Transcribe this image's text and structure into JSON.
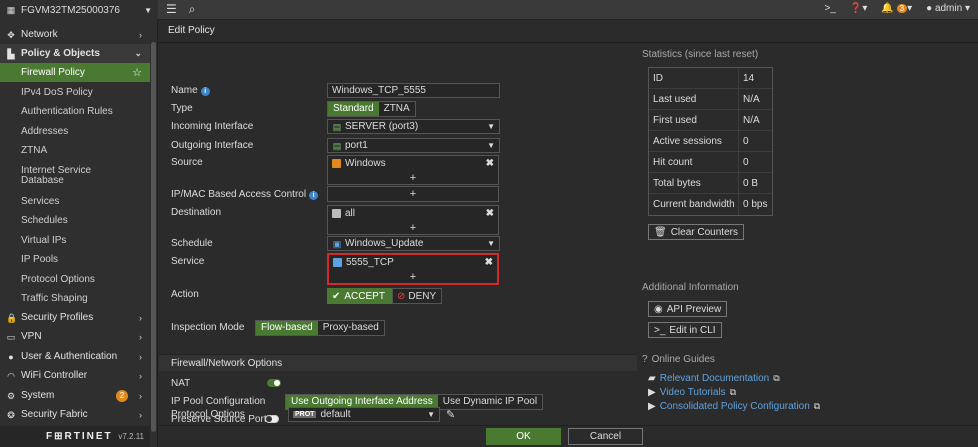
{
  "topbar": {
    "device_name": "FGVM32TM25000376",
    "notif_count": "3",
    "user": "admin"
  },
  "sidebar": {
    "items": [
      {
        "label": "Network"
      },
      {
        "label": "Policy & Objects"
      }
    ],
    "sub": [
      "Firewall Policy",
      "IPv4 DoS Policy",
      "Authentication Rules",
      "Addresses",
      "ZTNA",
      "Internet Service Database",
      "Services",
      "Schedules",
      "Virtual IPs",
      "IP Pools",
      "Protocol Options",
      "Traffic Shaping"
    ],
    "lower": [
      {
        "label": "Security Profiles"
      },
      {
        "label": "VPN"
      },
      {
        "label": "User & Authentication"
      },
      {
        "label": "WiFi Controller"
      },
      {
        "label": "System",
        "badge": "2"
      },
      {
        "label": "Security Fabric"
      }
    ],
    "logo": "F⊞RTINET",
    "version": "v7.2.11"
  },
  "page": {
    "title": "Edit Policy"
  },
  "form": {
    "name_label": "Name",
    "name_value": "Windows_TCP_5555",
    "type_label": "Type",
    "type_options": [
      "Standard",
      "ZTNA"
    ],
    "incoming_label": "Incoming Interface",
    "incoming_value": "SERVER (port3)",
    "outgoing_label": "Outgoing Interface",
    "outgoing_value": "port1",
    "source_label": "Source",
    "source_value": "Windows",
    "ipmac_label": "IP/MAC Based Access Control",
    "destination_label": "Destination",
    "destination_value": "all",
    "schedule_label": "Schedule",
    "schedule_value": "Windows_Update",
    "service_label": "Service",
    "service_value": "5555_TCP",
    "action_label": "Action",
    "accept_label": "ACCEPT",
    "deny_label": "DENY",
    "inspection_label": "Inspection Mode",
    "inspection_options": [
      "Flow-based",
      "Proxy-based"
    ],
    "fw_section": "Firewall/Network Options",
    "nat_label": "NAT",
    "ippool_label": "IP Pool Configuration",
    "ippool_options": [
      "Use Outgoing Interface Address",
      "Use Dynamic IP Pool"
    ],
    "preserve_label": "Preserve Source Port",
    "protocol_label": "Protocol Options",
    "protocol_badge": "PROT",
    "protocol_value": "default",
    "plus": "+",
    "remove": "✖"
  },
  "stats": {
    "title": "Statistics (since last reset)",
    "rows": [
      {
        "k": "ID",
        "v": "14"
      },
      {
        "k": "Last used",
        "v": "N/A"
      },
      {
        "k": "First used",
        "v": "N/A"
      },
      {
        "k": "Active sessions",
        "v": "0"
      },
      {
        "k": "Hit count",
        "v": "0"
      },
      {
        "k": "Total bytes",
        "v": "0 B"
      },
      {
        "k": "Current bandwidth",
        "v": "0 bps"
      }
    ],
    "clear_label": "Clear Counters"
  },
  "additional": {
    "title": "Additional Information",
    "api_label": "API Preview",
    "cli_label": "Edit in CLI"
  },
  "guides": {
    "title": "Online Guides",
    "links": [
      "Relevant Documentation",
      "Video Tutorials",
      "Consolidated Policy Configuration"
    ]
  },
  "footer": {
    "ok": "OK",
    "cancel": "Cancel"
  }
}
